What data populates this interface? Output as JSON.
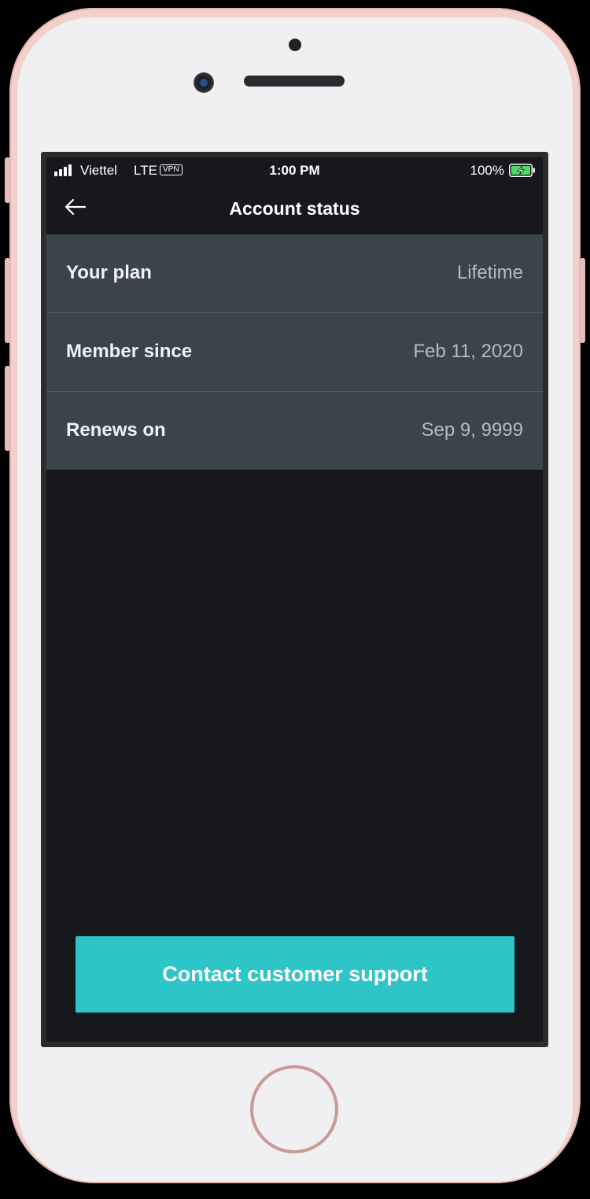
{
  "status_bar": {
    "carrier": "Viettel",
    "network": "LTE",
    "vpn": "VPN",
    "time": "1:00 PM",
    "battery_percent": "100%"
  },
  "header": {
    "title": "Account status",
    "back_icon": "arrow-left-icon"
  },
  "account_info": [
    {
      "label": "Your plan",
      "value": "Lifetime"
    },
    {
      "label": "Member since",
      "value": "Feb 11, 2020"
    },
    {
      "label": "Renews on",
      "value": "Sep 9, 9999"
    }
  ],
  "actions": {
    "contact_label": "Contact customer support"
  },
  "colors": {
    "screen_background": "#16181c",
    "row_background": "#3b434b",
    "accent": "#2ec5c8",
    "battery": "#4cd964"
  }
}
